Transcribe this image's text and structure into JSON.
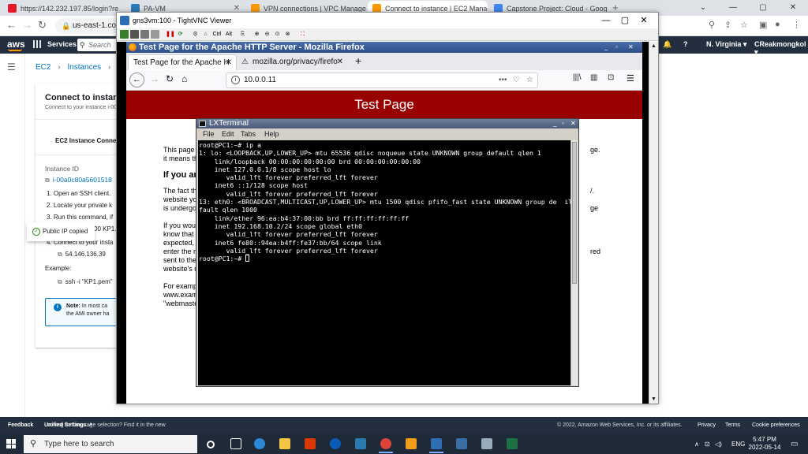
{
  "chrome": {
    "tabs": [
      {
        "title": "https://142.232.197.85/login?redi",
        "color": "#e21a2c"
      },
      {
        "title": "PA-VM",
        "color": "#2b7ab8"
      },
      {
        "title": "VPN connections | VPC Manage",
        "color": "#ff9900"
      },
      {
        "title": "Connect to instance | EC2 Manag",
        "color": "#ff9900"
      },
      {
        "title": "Capstone Project: Cloud - Googl",
        "color": "#4285f4"
      }
    ],
    "url": "us-east-1.cons",
    "window_buttons": [
      "⌄",
      "—",
      "▢",
      "✕"
    ]
  },
  "aws": {
    "logo": "aws",
    "services": "Services",
    "search_placeholder": "Search",
    "region": "N. Virginia ▾",
    "user": "CReakmongkol ▾",
    "breadcrumb": [
      "EC2",
      "Instances",
      "i-00"
    ],
    "panel": {
      "title": "Connect to instan",
      "subtitle": "Connect to your instance i-00",
      "tab": "EC2 Instance Connec",
      "instance_id_label": "Instance ID",
      "instance_id": "i-00a0c80a5601518",
      "steps": [
        "1. Open an SSH client.",
        "2. Locate your private k",
        "3. Run this command, if",
        "00 KP1.",
        "4. Connect to your insta",
        "54.146.136.39"
      ],
      "example_label": "Example:",
      "example_cmd": "ssh -i \"KP1.pem\"",
      "note_bold": "Note:",
      "note_text": "In most ca",
      "note_text2": "the AMI owner ha"
    },
    "toast": "Public IP copied",
    "footer": {
      "feedback": "Feedback",
      "language": "Looking for language selection? Find it in the new",
      "unified": "Unified Settings",
      "copyright": "© 2022, Amazon Web Services, Inc. or its affiliates.",
      "privacy": "Privacy",
      "terms": "Terms",
      "cookies": "Cookie preferences"
    }
  },
  "vnc": {
    "title": "gns3vm:100 - TightVNC Viewer",
    "toolbar_text": [
      "Ctrl",
      "Alt"
    ]
  },
  "firefox": {
    "window_title": "Test Page for the Apache HTTP Server - Mozilla Firefox",
    "tabs": [
      "Test Page for the Apache H",
      "mozilla.org/privacy/firefo"
    ],
    "url": "10.0.0.11",
    "page": {
      "banner": "Test Page",
      "lines": [
        "This page is",
        "it means tha",
        "If you are",
        "The fact tha",
        "website you",
        "is undergoin",
        "If you would",
        "know that y",
        "expected, y",
        "enter the n",
        "sent to the",
        "website's d",
        "For example",
        "www.examp",
        "\"webmaster"
      ],
      "right_fragments": [
        "ge.",
        "/.",
        "ge",
        "red"
      ]
    }
  },
  "lxterminal": {
    "title": "LXTerminal",
    "menu": [
      "File",
      "Edit",
      "Tabs",
      "Help"
    ],
    "output": "root@PC1:~# ip a\n1: lo: <LOOPBACK,UP,LOWER_UP> mtu 65536 qdisc noqueue state UNKNOWN group default qlen 1\n    link/loopback 00:00:00:00:00:00 brd 00:00:00:00:00:00\n    inet 127.0.0.1/8 scope host lo\n       valid_lft forever preferred_lft forever\n    inet6 ::1/128 scope host\n       valid_lft forever preferred_lft forever\n13: eth0: <BROADCAST,MULTICAST,UP,LOWER_UP> mtu 1500 qdisc pfifo_fast state UNKNOWN group de  ill\nfault qlen 1000\n    link/ether 96:ea:b4:37:00:bb brd ff:ff:ff:ff:ff:ff\n    inet 192.168.10.2/24 scope global eth0\n       valid_lft forever preferred_lft forever\n    inet6 fe80::94ea:b4ff:fe37:bb/64 scope link\n       valid_lft forever preferred_lft forever\n",
    "prompt": "root@PC1:~# "
  },
  "taskbar": {
    "search_placeholder": "Type here to search",
    "language": "ENG",
    "time": "5:47 PM",
    "date": "2022-05-14"
  }
}
